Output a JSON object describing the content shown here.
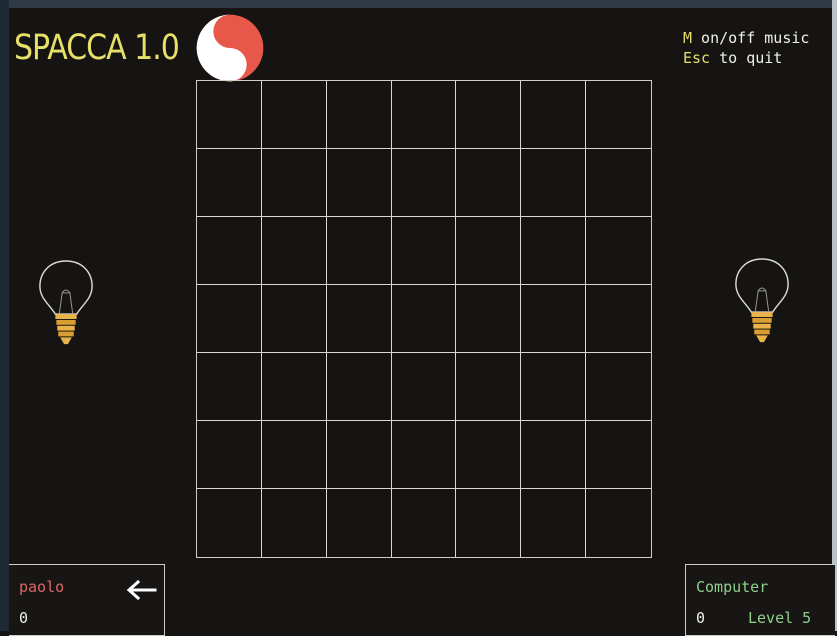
{
  "header": {
    "title": "SPACCA 1.0",
    "logo_icon": "yin-yang-icon"
  },
  "help": {
    "music_key": "M",
    "music_text": " on/off music",
    "quit_key": "Esc",
    "quit_text": " to quit"
  },
  "board": {
    "rows": 7,
    "cols": 7
  },
  "players": {
    "left": {
      "name": "paolo",
      "score": "0",
      "lamp_icon": "light-bulb-icon",
      "turn_indicator_icon": "left-arrow-icon"
    },
    "right": {
      "name": "Computer",
      "score": "0",
      "level": "Level 5",
      "lamp_icon": "light-bulb-icon"
    }
  },
  "colors": {
    "background": "#151412",
    "title": "#e6e06a",
    "grid": "#d8d8cc",
    "player_left": "#e06666",
    "player_right": "#8fd18a",
    "yin_yang_red": "#e8584a"
  }
}
